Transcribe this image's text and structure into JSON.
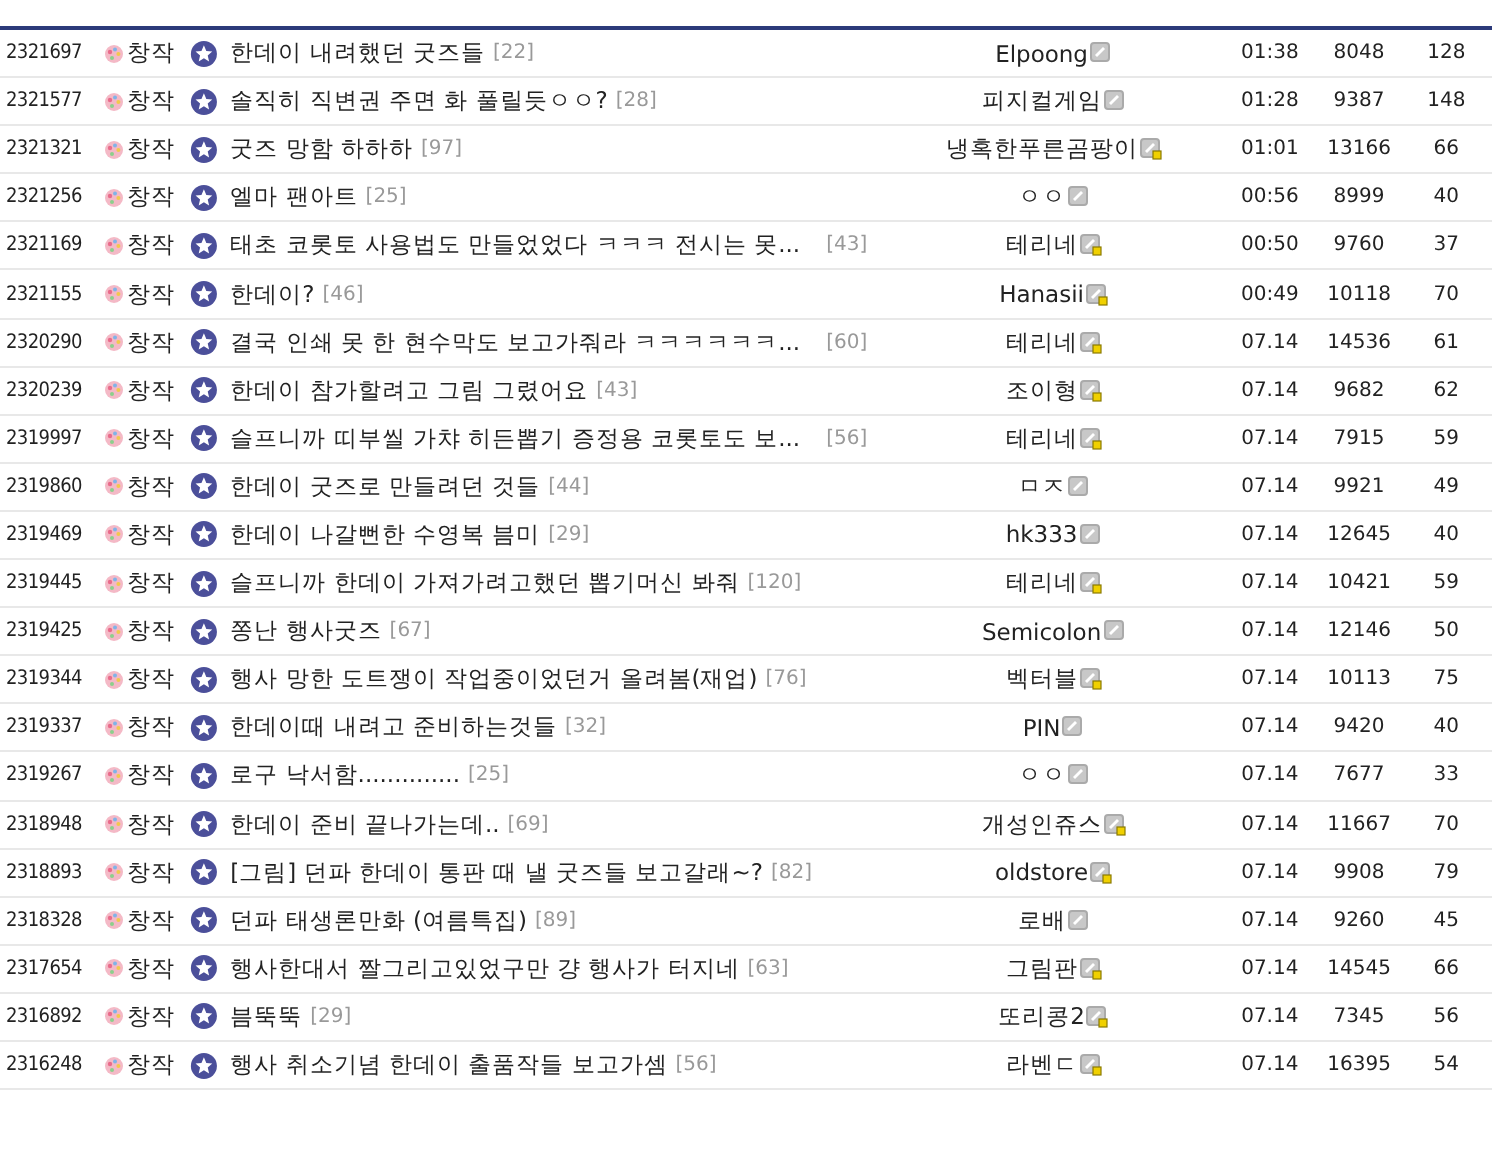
{
  "rows": [
    {
      "number": "2321697",
      "category": "창작",
      "title": "한데이 내려했던 굿즈들",
      "cut": false,
      "comments": "[22]",
      "author": "Elpoong",
      "gold_badge": false,
      "date": "01:38",
      "views": "8048",
      "recommends": "128"
    },
    {
      "number": "2321577",
      "category": "창작",
      "title": "솔직히 직변권 주면 화 풀릴듯ㅇㅇ?",
      "cut": false,
      "comments": "[28]",
      "author": "피지컬게임",
      "gold_badge": false,
      "date": "01:28",
      "views": "9387",
      "recommends": "148"
    },
    {
      "number": "2321321",
      "category": "창작",
      "title": "굿즈 망함 하하하",
      "cut": false,
      "comments": "[97]",
      "author": "냉혹한푸른곰팡이",
      "gold_badge": true,
      "date": "01:01",
      "views": "13166",
      "recommends": "66"
    },
    {
      "number": "2321256",
      "category": "창작",
      "title": "엘마 팬아트",
      "cut": false,
      "comments": "[25]",
      "author": "ㅇㅇ",
      "gold_badge": false,
      "date": "00:56",
      "views": "8999",
      "recommends": "40"
    },
    {
      "number": "2321169",
      "category": "창작",
      "title": "태초 코롯토 사용법도 만들었었다 ㅋㅋㅋ 전시는 못...",
      "cut": true,
      "comments": "[43]",
      "author": "테리네",
      "gold_badge": true,
      "date": "00:50",
      "views": "9760",
      "recommends": "37"
    },
    {
      "number": "2321155",
      "category": "창작",
      "title": "한데이?",
      "cut": false,
      "comments": "[46]",
      "author": "Hanasii",
      "gold_badge": true,
      "date": "00:49",
      "views": "10118",
      "recommends": "70"
    },
    {
      "number": "2320290",
      "category": "창작",
      "title": "결국 인쇄 못 한 현수막도 보고가줘라 ㅋㅋㅋㅋㅋㅋ...",
      "cut": true,
      "comments": "[60]",
      "author": "테리네",
      "gold_badge": true,
      "date": "07.14",
      "views": "14536",
      "recommends": "61"
    },
    {
      "number": "2320239",
      "category": "창작",
      "title": "한데이 참가할려고 그림 그렸어요",
      "cut": false,
      "comments": "[43]",
      "author": "조이형",
      "gold_badge": true,
      "date": "07.14",
      "views": "9682",
      "recommends": "62"
    },
    {
      "number": "2319997",
      "category": "창작",
      "title": "슬프니까 띠부씰 가챠 히든뽑기 증정용 코롯토도 보...",
      "cut": true,
      "comments": "[56]",
      "author": "테리네",
      "gold_badge": true,
      "date": "07.14",
      "views": "7915",
      "recommends": "59"
    },
    {
      "number": "2319860",
      "category": "창작",
      "title": "한데이 굿즈로 만들려던 것들",
      "cut": false,
      "comments": "[44]",
      "author": "ㅁㅈ",
      "gold_badge": false,
      "date": "07.14",
      "views": "9921",
      "recommends": "49"
    },
    {
      "number": "2319469",
      "category": "창작",
      "title": "한데이 나갈뻔한 수영복 븜미",
      "cut": false,
      "comments": "[29]",
      "author": "hk333",
      "gold_badge": false,
      "date": "07.14",
      "views": "12645",
      "recommends": "40"
    },
    {
      "number": "2319445",
      "category": "창작",
      "title": "슬프니까 한데이 가져가려고했던 뽑기머신 봐줘",
      "cut": false,
      "comments": "[120]",
      "author": "테리네",
      "gold_badge": true,
      "date": "07.14",
      "views": "10421",
      "recommends": "59"
    },
    {
      "number": "2319425",
      "category": "창작",
      "title": "쫑난 행사굿즈",
      "cut": false,
      "comments": "[67]",
      "author": "Semicolon",
      "gold_badge": false,
      "date": "07.14",
      "views": "12146",
      "recommends": "50"
    },
    {
      "number": "2319344",
      "category": "창작",
      "title": "행사 망한 도트쟁이 작업중이었던거 올려봄(재업)",
      "cut": false,
      "comments": "[76]",
      "author": "벡터블",
      "gold_badge": true,
      "date": "07.14",
      "views": "10113",
      "recommends": "75"
    },
    {
      "number": "2319337",
      "category": "창작",
      "title": "한데이때 내려고 준비하는것들",
      "cut": false,
      "comments": "[32]",
      "author": "PIN",
      "gold_badge": false,
      "date": "07.14",
      "views": "9420",
      "recommends": "40"
    },
    {
      "number": "2319267",
      "category": "창작",
      "title": "로구 낙서함..............",
      "cut": false,
      "comments": "[25]",
      "author": "ㅇㅇ",
      "gold_badge": false,
      "date": "07.14",
      "views": "7677",
      "recommends": "33"
    },
    {
      "number": "2318948",
      "category": "창작",
      "title": "한데이 준비 끝나가는데..",
      "cut": false,
      "comments": "[69]",
      "author": "개성인쥬스",
      "gold_badge": true,
      "date": "07.14",
      "views": "11667",
      "recommends": "70"
    },
    {
      "number": "2318893",
      "category": "창작",
      "title": "[그림] 던파 한데이 통판 때 낼 굿즈들 보고갈래~?",
      "cut": false,
      "comments": "[82]",
      "author": "oldstore",
      "gold_badge": true,
      "date": "07.14",
      "views": "9908",
      "recommends": "79"
    },
    {
      "number": "2318328",
      "category": "창작",
      "title": "던파 태생론만화 (여름특집)",
      "cut": false,
      "comments": "[89]",
      "author": "로배",
      "gold_badge": false,
      "date": "07.14",
      "views": "9260",
      "recommends": "45"
    },
    {
      "number": "2317654",
      "category": "창작",
      "title": "행사한대서 짤그리고있었구만 걍 행사가 터지네",
      "cut": false,
      "comments": "[63]",
      "author": "그림판",
      "gold_badge": true,
      "date": "07.14",
      "views": "14545",
      "recommends": "66"
    },
    {
      "number": "2316892",
      "category": "창작",
      "title": "븜뚝뚝",
      "cut": false,
      "comments": "[29]",
      "author": "또리콩2",
      "gold_badge": true,
      "date": "07.14",
      "views": "7345",
      "recommends": "56"
    },
    {
      "number": "2316248",
      "category": "창작",
      "title": "행사 취소기념 한데이 출품작들 보고가셈",
      "cut": false,
      "comments": "[56]",
      "author": "라벤ㄷ",
      "gold_badge": true,
      "date": "07.14",
      "views": "16395",
      "recommends": "54"
    }
  ]
}
